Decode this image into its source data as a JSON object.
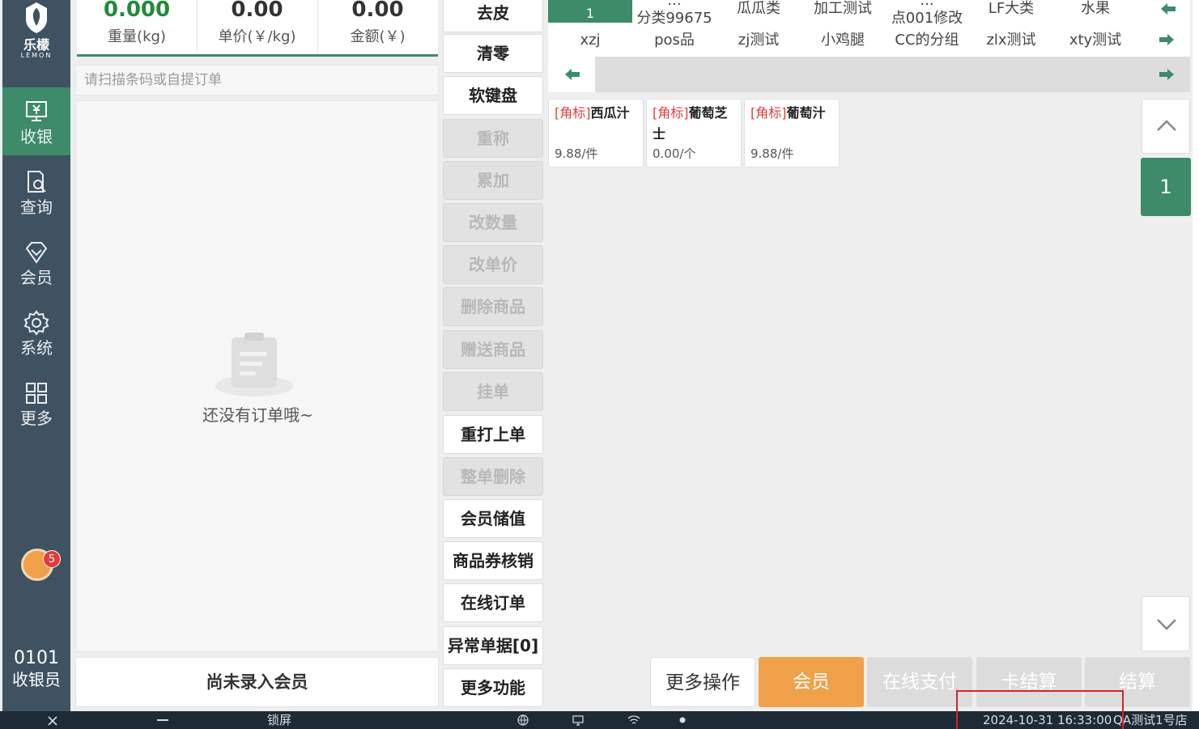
{
  "brand": {
    "name_cn": "乐檬",
    "name_en": "LEMON"
  },
  "nav": {
    "items": [
      {
        "label": "收银",
        "icon": "cash-register-icon",
        "active": true
      },
      {
        "label": "查询",
        "icon": "search-document-icon",
        "active": false
      },
      {
        "label": "会员",
        "icon": "diamond-icon",
        "active": false
      },
      {
        "label": "系统",
        "icon": "gear-icon",
        "active": false
      },
      {
        "label": "更多",
        "icon": "grid-icon",
        "active": false
      }
    ],
    "notification_count": "5",
    "operator_id": "0101",
    "operator_role": "收银员"
  },
  "scale": {
    "weight_value": "0.000",
    "weight_label": "重量(kg)",
    "unit_price_value": "0.00",
    "unit_price_label": "单价(￥/kg)",
    "amount_value": "0.00",
    "amount_label": "金额(￥)"
  },
  "scan": {
    "placeholder": "请扫描条码或自提订单"
  },
  "order": {
    "empty_text": "还没有订单哦~"
  },
  "member_bar": {
    "label": "尚未录入会员"
  },
  "functions": [
    {
      "label": "去皮",
      "enabled": true
    },
    {
      "label": "清零",
      "enabled": true
    },
    {
      "label": "软键盘",
      "enabled": true
    },
    {
      "label": "重称",
      "enabled": false
    },
    {
      "label": "累加",
      "enabled": false
    },
    {
      "label": "改数量",
      "enabled": false
    },
    {
      "label": "改单价",
      "enabled": false
    },
    {
      "label": "删除商品",
      "enabled": false
    },
    {
      "label": "赠送商品",
      "enabled": false
    },
    {
      "label": "挂单",
      "enabled": false
    },
    {
      "label": "重打上单",
      "enabled": true
    },
    {
      "label": "整单删除",
      "enabled": false
    },
    {
      "label": "会员储值",
      "enabled": true
    },
    {
      "label": "商品券核销",
      "enabled": true
    },
    {
      "label": "在线订单",
      "enabled": true
    },
    {
      "label": "异常单据[0]",
      "enabled": true
    },
    {
      "label": "更多功能",
      "enabled": true
    }
  ],
  "categories": {
    "row1": [
      {
        "line1": "...",
        "line2": "1",
        "active": true
      },
      {
        "line1": "...",
        "line2": "分类99675"
      },
      {
        "line1": "瓜瓜类",
        "line2": ""
      },
      {
        "line1": "加工测试",
        "line2": ""
      },
      {
        "line1": "...",
        "line2": "点001修改"
      },
      {
        "line1": "LF大类",
        "line2": ""
      },
      {
        "line1": "水果",
        "line2": ""
      }
    ],
    "row2": [
      "xzj",
      "pos品",
      "zj测试",
      "小鸡腿",
      "CC的分组",
      "zlx测试",
      "xty测试"
    ]
  },
  "products": [
    {
      "tag": "[角标]",
      "name": "西瓜汁",
      "price": "9.88/件"
    },
    {
      "tag": "[角标]",
      "name": "葡萄芝士",
      "price": "0.00/个"
    },
    {
      "tag": "[角标]",
      "name": "葡萄汁",
      "price": "9.88/件"
    }
  ],
  "pager": {
    "current_page": "1"
  },
  "actions": [
    {
      "label": "更多操作",
      "style": "normal"
    },
    {
      "label": "会员",
      "style": "primary"
    },
    {
      "label": "在线支付",
      "style": "disabled"
    },
    {
      "label": "卡结算",
      "style": "disabled"
    },
    {
      "label": "结算",
      "style": "disabled"
    }
  ],
  "statusbar": {
    "lock_label": "锁屏",
    "datetime": "2024-10-31 16:33:00",
    "store": "QA测试1号店"
  },
  "colors": {
    "nav_bg": "#3f5262",
    "accent_green": "#3d8b68",
    "accent_orange": "#f1a04a",
    "tag_red": "#e33b3b"
  }
}
